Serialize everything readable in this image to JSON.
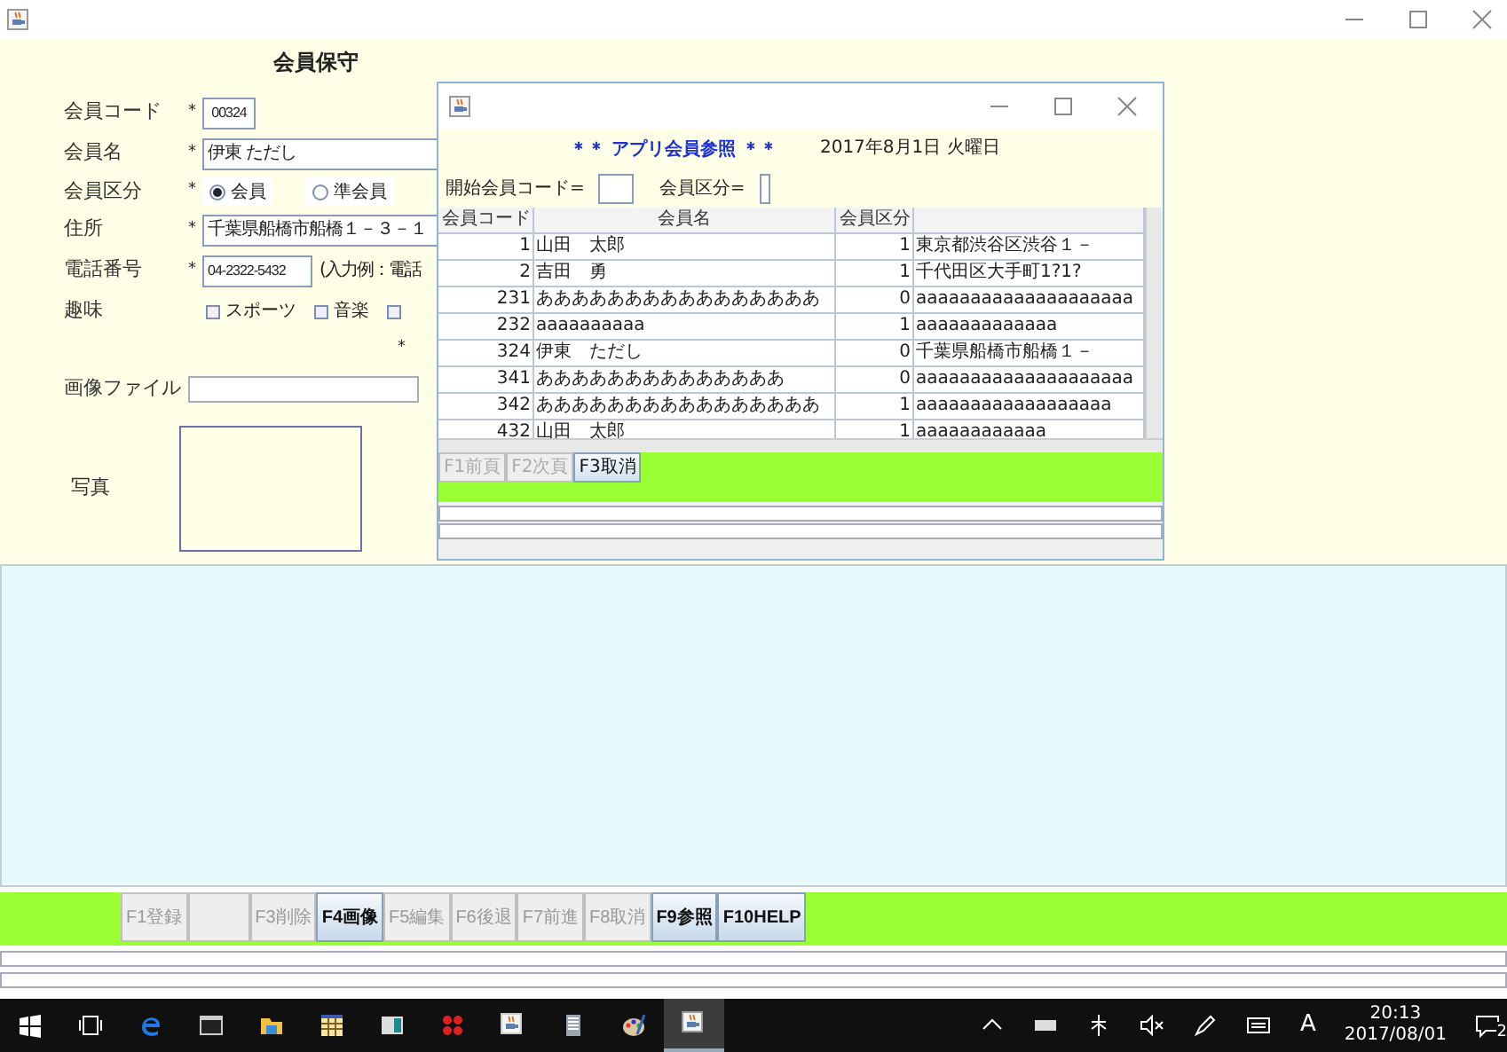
{
  "form": {
    "title": "会員保守",
    "fields": [
      {
        "kind": "text",
        "label": "会員コード",
        "required": "*",
        "value": "00324"
      },
      {
        "kind": "text",
        "label": "会員名",
        "required": "*",
        "value": "伊東 ただし"
      },
      {
        "kind": "radio",
        "label": "会員区分",
        "required": "*",
        "options": [
          {
            "label": "会員",
            "selected": true
          },
          {
            "label": "準会員",
            "selected": false
          }
        ]
      },
      {
        "kind": "text",
        "label": "住所",
        "required": "*",
        "value": "千葉県船橋市船橋１－３－１"
      },
      {
        "kind": "text",
        "label": "電話番号",
        "required": "*",
        "value": "04-2322-5432",
        "hint": "(入力例：電話"
      },
      {
        "kind": "checks",
        "label": "趣味",
        "options": [
          {
            "label": "スポーツ",
            "checked": false
          },
          {
            "label": "音楽",
            "checked": false
          },
          {
            "checked": false
          }
        ]
      },
      {
        "kind": "mark",
        "required": "*"
      },
      {
        "kind": "file",
        "label": "画像ファイル"
      },
      {
        "kind": "photo",
        "label": "写真"
      }
    ]
  },
  "function_keys": [
    {
      "label": "F1登録",
      "enabled": false
    },
    {
      "enabled": false
    },
    {
      "label": "F3削除",
      "enabled": false
    },
    {
      "label": "F4画像",
      "enabled": true
    },
    {
      "label": "F5編集",
      "enabled": false
    },
    {
      "label": "F6後退",
      "enabled": false
    },
    {
      "label": "F7前進",
      "enabled": false
    },
    {
      "label": "F8取消",
      "enabled": false
    },
    {
      "label": "F9参照",
      "enabled": true
    },
    {
      "label": "F10HELP",
      "enabled": true
    }
  ],
  "dialog": {
    "heading": "＊＊ アプリ会員参照 ＊＊",
    "date": "2017年8月1日 火曜日",
    "filters": [
      {
        "label": "開始会員コード="
      },
      {
        "label": "会員区分="
      }
    ],
    "table": {
      "columns": [
        "会員コード",
        "会員名",
        "会員区分"
      ],
      "rows": [
        [
          "1",
          "山田　太郎",
          "1",
          "東京都渋谷区渋谷１－"
        ],
        [
          "2",
          "吉田　勇",
          "1",
          "千代田区大手町1?1?"
        ],
        [
          "231",
          "ああああああああああああああああ",
          "0",
          "aaaaaaaaaaaaaaaaaaaa"
        ],
        [
          "232",
          "aaaaaaaaaa",
          "1",
          "aaaaaaaaaaaaa"
        ],
        [
          "324",
          "伊東　ただし",
          "0",
          "千葉県船橋市船橋１－"
        ],
        [
          "341",
          "ああああああああああああああ",
          "0",
          "aaaaaaaaaaaaaaaaaaaa"
        ],
        [
          "342",
          "ああああああああああああああああ",
          "1",
          "aaaaaaaaaaaaaaaaaa"
        ],
        [
          "432",
          "山田　太郎",
          "1",
          "aaaaaaaaaaaa"
        ]
      ]
    },
    "buttons": [
      {
        "label": "F1前頁",
        "enabled": false
      },
      {
        "label": "F2次頁",
        "enabled": false
      },
      {
        "label": "F3取消",
        "enabled": true
      }
    ]
  },
  "taskbar": {
    "apps": [
      {
        "selected": false
      },
      {
        "selected": false
      },
      {
        "selected": false
      },
      {
        "selected": false
      },
      {
        "selected": false
      },
      {
        "selected": false
      },
      {
        "selected": false
      },
      {
        "selected": false
      },
      {
        "selected": false
      },
      {
        "selected": false
      },
      {
        "selected": false
      },
      {
        "selected": true
      }
    ],
    "ime": "A",
    "time": "20:13",
    "date": "2017/08/01",
    "notifications": "2"
  }
}
